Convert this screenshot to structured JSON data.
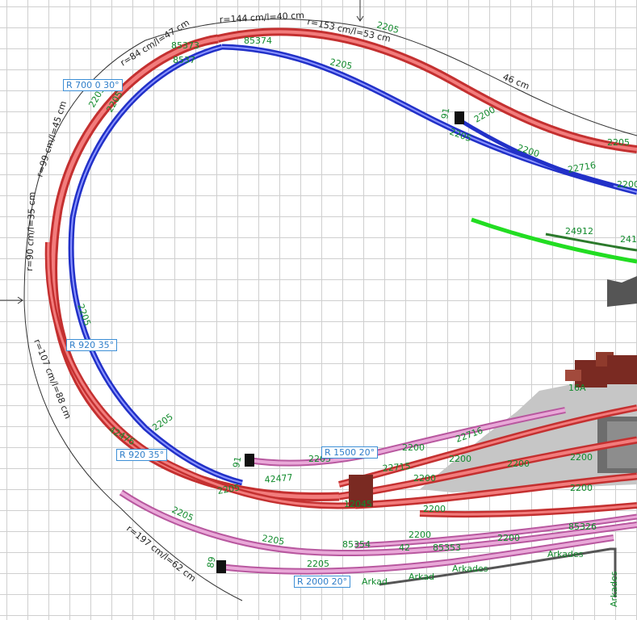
{
  "colors": {
    "track_red": "#e65a5a",
    "track_red_dark": "#c43030",
    "track_blue": "#2231c8",
    "track_pink": "#d98cc4",
    "track_green": "#22dd22",
    "label_green": "#118a2c",
    "tag_blue": "#2f7ec9",
    "building_brown": "#7a2a22",
    "platform_gray": "#c6c6c6"
  },
  "radius_tags": [
    "R 700 0 30°",
    "R 920 35°",
    "R 920 35°",
    "R 1500 20°",
    "R 2000 20°"
  ],
  "dimensions": [
    "r=144 cm/l=40 cm",
    "r=153 cm/l=53 cm",
    "46 cm",
    "r=84 cm/l=47 cm",
    "r=99 cm/l=45 cm",
    "r=90 cm/l=35 cm",
    "r=107 cm/l=88 cm",
    "r=197 cm/l=62 cm"
  ],
  "track_labels": {
    "t85373": "85373",
    "t85374": "85374",
    "t8537x": "8537",
    "t2205a": "2205",
    "t2205b": "2205",
    "t2205c": "2205",
    "t2205d": "2205",
    "t2205e": "2205",
    "t2205f": "2205",
    "t2205g": "2205",
    "t2205h": "2205",
    "t2205i": "2205",
    "t2205j": "2205",
    "t2205k": "2205",
    "t2205l": "2205",
    "t2205m": "2205",
    "t2200a": "2200",
    "t2200b": "2200",
    "t2200c": "2200",
    "t2200d": "2200",
    "t2200e": "2200",
    "t2200f": "2200",
    "t2200g": "2200",
    "t2200h": "2200",
    "t2200i": "2200",
    "t2200j": "2200",
    "t2200k": "2200",
    "t2200l": "2200",
    "t22716a": "22716",
    "t22716b": "22716",
    "t22715": "22715",
    "t24912": "24912",
    "t241": "241",
    "t42476": "42476",
    "t42477": "42477",
    "t85354": "85354",
    "t85353": "85353",
    "t85326": "85326",
    "t16a": "16A",
    "t42": "42",
    "t12045": "12045",
    "t91a": "91",
    "t91b": "91",
    "t89": "89",
    "arkad1": "Arkad",
    "arkad2": "Arkad",
    "arkad3": "Arkades",
    "arkad4": "Arkades",
    "arkad5": "Arkades"
  }
}
